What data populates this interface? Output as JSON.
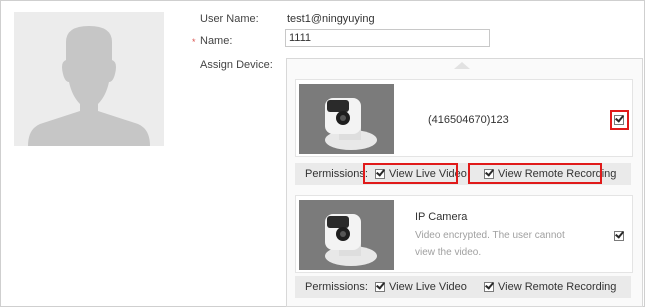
{
  "form": {
    "username_label": "User Name:",
    "username_value": "test1@ningyuying",
    "name_label": "Name:",
    "name_required_mark": "*",
    "name_value": "1111",
    "assign_label": "Assign Device:"
  },
  "devices": [
    {
      "title": "(416504670)123",
      "selected": true,
      "permissions_label": "Permissions:",
      "permissions": [
        {
          "label": "View Live Video",
          "checked": true
        },
        {
          "label": "View Remote Recording",
          "checked": true
        }
      ]
    },
    {
      "title": "IP Camera",
      "note": "Video encrypted. The user cannot view the video.",
      "selected": true,
      "permissions_label": "Permissions:",
      "permissions": [
        {
          "label": "View Live Video",
          "checked": true
        },
        {
          "label": "View Remote Recording",
          "checked": true
        }
      ]
    }
  ],
  "icons": {
    "avatar": "user-silhouette-icon",
    "device_thumb": "camera-icon",
    "scroll": "scroll-up-icon",
    "checkbox": "checkbox-checked-icon"
  },
  "colors": {
    "highlight": "#e01a1a",
    "avatar_bg": "#ececec",
    "permission_bar": "#eaeaea"
  }
}
